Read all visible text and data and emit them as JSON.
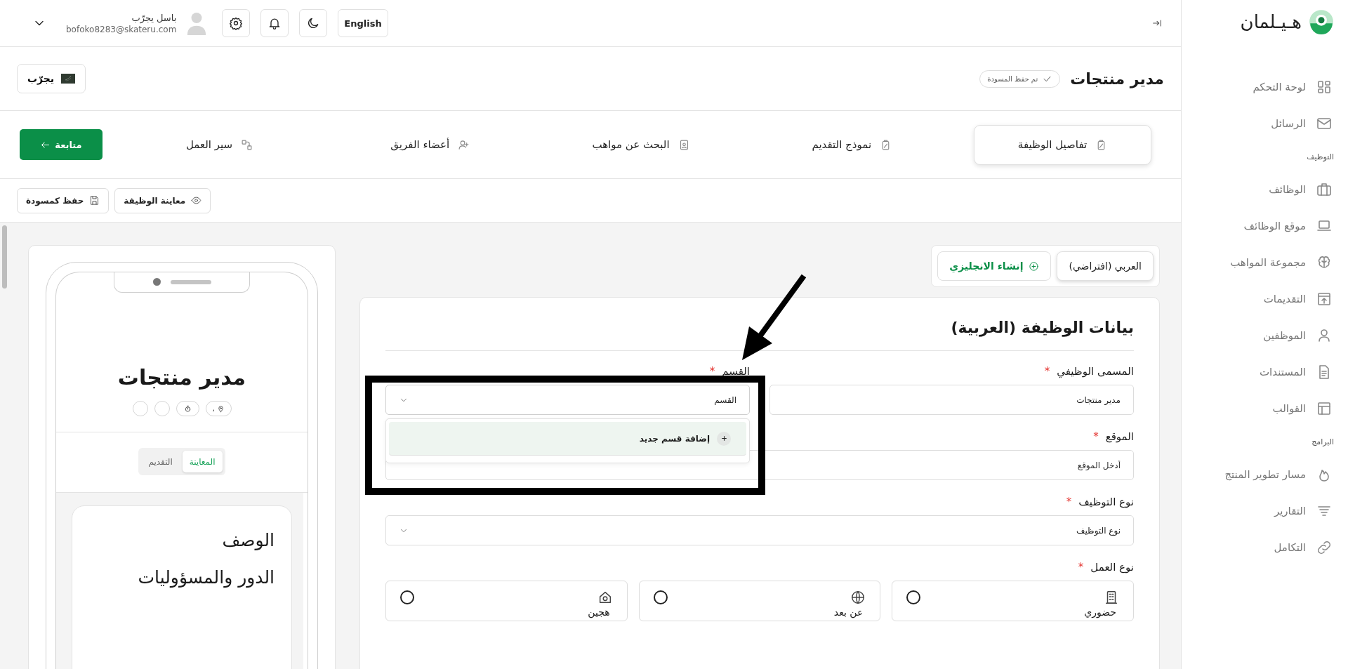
{
  "sidebar": {
    "brand": "هـيـلمان",
    "sections": [
      {
        "items": [
          {
            "label": "لوحة التحكم"
          },
          {
            "label": "الرسائل"
          }
        ]
      },
      {
        "heading": "التوظيف",
        "items": [
          {
            "label": "الوظائف"
          },
          {
            "label": "موقع الوظائف"
          },
          {
            "label": "مجموعة المواهب"
          },
          {
            "label": "التقديمات"
          },
          {
            "label": "الموظفين"
          },
          {
            "label": "المستندات"
          },
          {
            "label": "القوالب"
          }
        ]
      },
      {
        "heading": "البرامج",
        "items": [
          {
            "label": "مسار تطوير المنتج"
          },
          {
            "label": "التقارير"
          },
          {
            "label": "التكامل"
          }
        ]
      }
    ]
  },
  "topbar": {
    "language": "English",
    "user": {
      "name": "باسل يجرّب",
      "email": "bofoko8283@skateru.com"
    }
  },
  "header": {
    "title": "مدير منتجات",
    "status": "تم حفظ المسودة",
    "company": "يجرّب"
  },
  "steps": {
    "tabs": [
      {
        "label": "تفاصيل الوظيفة",
        "selected": true
      },
      {
        "label": "نموذج التقديم",
        "selected": false
      },
      {
        "label": "البحث عن مواهب",
        "selected": false
      },
      {
        "label": "أعضاء الفريق",
        "selected": false
      },
      {
        "label": "سير العمل",
        "selected": false
      }
    ],
    "continue": "متابعة"
  },
  "actions": [
    "معاينة الوظيفة",
    "حفظ كمسودة"
  ],
  "languages": {
    "options": [
      {
        "label": "العربي (افتراضي)",
        "selected": true
      }
    ],
    "create": "إنشاء الانجليزي"
  },
  "form": {
    "heading": "بيانات الوظيفة (العربية)",
    "rows": [
      [
        {
          "kind": "text",
          "label": "المسمى الوظيفي",
          "mark": "*",
          "value": "مدير منتجات"
        },
        {
          "kind": "select",
          "label": "القسم",
          "mark": "*",
          "placeholder": "القسم",
          "expanded": true,
          "menu": [
            "إضافة قسم جديد"
          ]
        }
      ],
      [
        {
          "kind": "text",
          "label": "الموقع",
          "mark": "*",
          "placeholder": "أدخل الموقع"
        }
      ],
      [
        {
          "kind": "select",
          "label": "نوع التوظيف",
          "mark": "*",
          "placeholder": "نوع التوظيف",
          "expanded": false
        }
      ],
      [
        {
          "kind": "choice",
          "label": "نوع العمل",
          "mark": "*",
          "options": [
            {
              "label": "حضوري",
              "selected": false
            },
            {
              "label": "عن بعد",
              "selected": false
            },
            {
              "label": "هجين",
              "selected": false
            }
          ]
        }
      ]
    ]
  },
  "preview": {
    "title": "مدير منتجات",
    "chips": [
      {
        "kind": "location",
        "text": "،"
      },
      {
        "kind": "timer"
      },
      {
        "kind": "empty"
      },
      {
        "kind": "empty"
      }
    ],
    "tabs": [
      {
        "label": "المعاينة",
        "selected": true
      },
      {
        "label": "التقديم",
        "selected": false
      }
    ],
    "sections": [
      "الوصف",
      "الدور والمسؤوليات"
    ]
  }
}
